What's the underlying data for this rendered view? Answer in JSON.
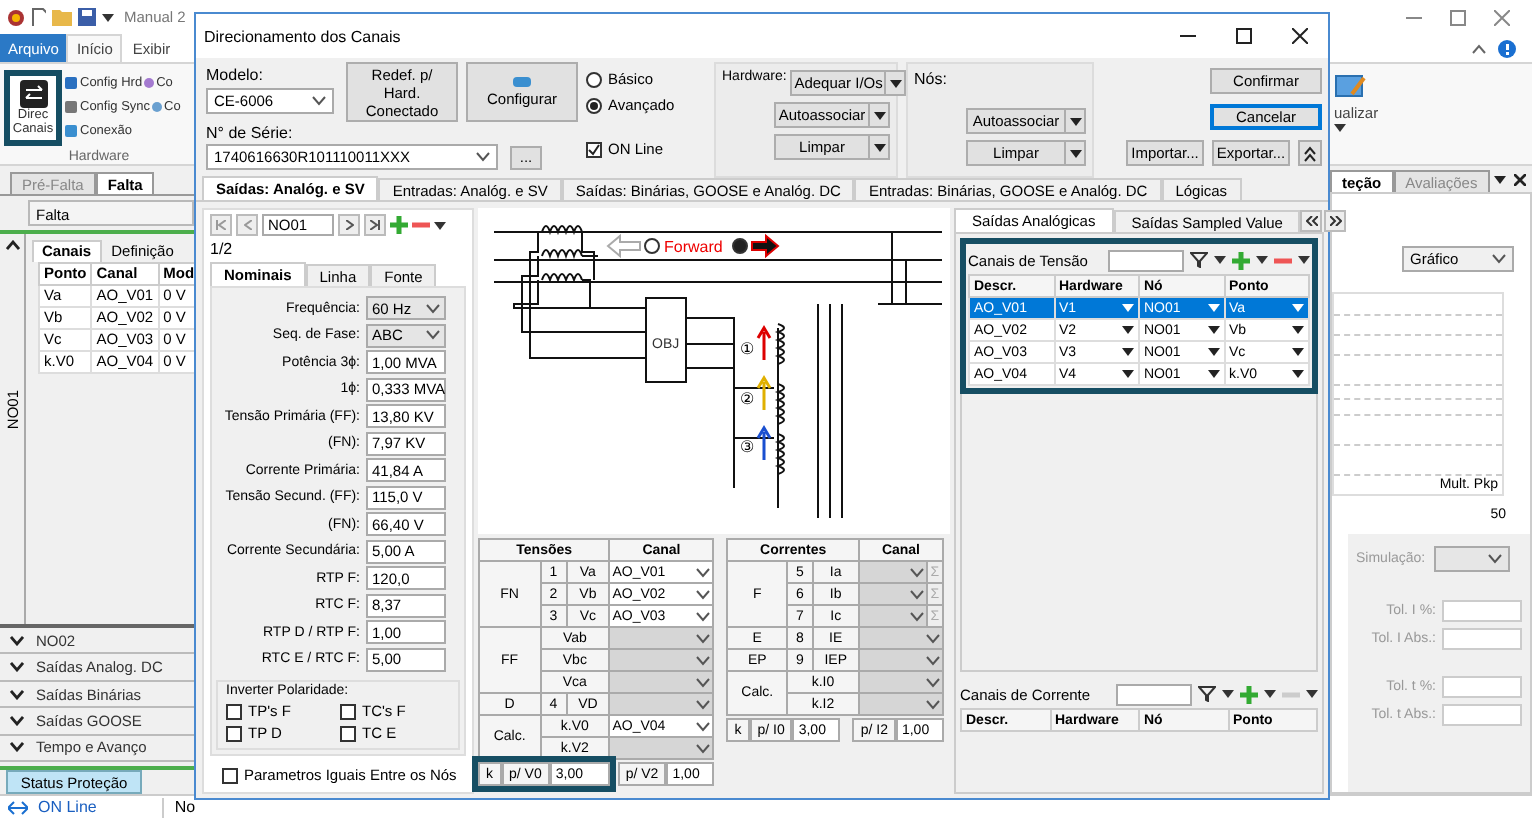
{
  "app": {
    "title": "Manual 2",
    "file_tab": "Arquivo",
    "menu_tabs": [
      {
        "label": "Início",
        "selected": true
      },
      {
        "label": "Exibir",
        "selected": false
      }
    ],
    "ribbon": {
      "main_button": [
        "Direc",
        "Canais"
      ],
      "buttons": [
        "Config Hrd",
        "Config Sync",
        "Conexão"
      ],
      "cut_buttons": [
        "Co",
        "Co"
      ],
      "group_label": "Hardware",
      "update_button": "ualizar"
    }
  },
  "left_panel": {
    "tabs": [
      {
        "label": "Pré-Falta",
        "selected": false
      },
      {
        "label": "Falta",
        "selected": true
      }
    ],
    "field": "Falta",
    "node": {
      "label": "NO01",
      "expanded": true,
      "tabs": [
        {
          "label": "Canais",
          "selected": true
        },
        {
          "label": "Definição",
          "selected": false
        }
      ],
      "columns": [
        "Ponto",
        "Canal",
        "Mod"
      ],
      "rows": [
        [
          "Va",
          "AO_V01",
          "0 V"
        ],
        [
          "Vb",
          "AO_V02",
          "0 V"
        ],
        [
          "Vc",
          "AO_V03",
          "0 V"
        ],
        [
          "k.V0",
          "AO_V04",
          "0 V"
        ]
      ]
    },
    "sections": [
      {
        "label": "NO02",
        "expanded": false
      },
      {
        "label": "Saídas Analog. DC",
        "expanded": false
      },
      {
        "label": "Saídas Binárias",
        "expanded": false
      },
      {
        "label": "Saídas GOOSE",
        "expanded": false
      },
      {
        "label": "Tempo e Avanço",
        "expanded": false
      }
    ],
    "bottom_tab": "Status Proteção"
  },
  "status_bar": {
    "connection": "ON Line",
    "column_2": "No"
  },
  "right_panel": {
    "tabs": [
      {
        "label": "teção",
        "selected": true
      },
      {
        "label": "Avaliações",
        "selected": false
      }
    ],
    "view_select": "Gráfico",
    "chart_label": "Mult. Pkp",
    "axis_value": "50",
    "simulation_label": "Simulação:",
    "fields": [
      "Tol. I %:",
      "Tol. I Abs.:",
      "Tol. t %:",
      "Tol. t Abs.:"
    ]
  },
  "dialog": {
    "title": "Direcionamento dos Canais",
    "model_label": "Modelo:",
    "model": "CE-6006",
    "reset_button": "Redef. p/ Hard. Conectado",
    "configure_button": "Configurar",
    "modes": [
      {
        "label": "Básico",
        "selected": false
      },
      {
        "label": "Avançado",
        "selected": true
      }
    ],
    "serial_label": "N° de Série:",
    "serial": "1740616630R101110011XXX",
    "browse_button": "...",
    "online": {
      "label": "ON Line",
      "checked": true
    },
    "hardware_group": {
      "label": "Hardware:",
      "buttons": [
        "Adequar I/Os",
        "Autoassociar",
        "Limpar"
      ]
    },
    "nodes_group": {
      "label": "Nós:",
      "buttons": [
        "Autoassociar",
        "Limpar"
      ]
    },
    "actions": [
      {
        "label": "Confirmar",
        "focused": false
      },
      {
        "label": "Cancelar",
        "focused": true
      }
    ],
    "import_button": "Importar...",
    "export_button": "Exportar...",
    "tabs": [
      {
        "label": "Saídas: Analóg. e SV",
        "selected": true
      },
      {
        "label": "Entradas: Analóg. e SV",
        "selected": false
      },
      {
        "label": "Saídas: Binárias, GOOSE e Analóg. DC",
        "selected": false
      },
      {
        "label": "Entradas: Binárias, GOOSE e Analóg. DC",
        "selected": false
      },
      {
        "label": "Lógicas",
        "selected": false
      }
    ],
    "navigator": {
      "node": "NO01",
      "page": "1/2"
    },
    "settings_tabs": [
      {
        "label": "Nominais",
        "selected": true
      },
      {
        "label": "Linha",
        "selected": false
      },
      {
        "label": "Fonte",
        "selected": false
      }
    ],
    "settings": [
      {
        "label": "Frequência:",
        "value": "60 Hz",
        "kind": "select"
      },
      {
        "label": "Seq. de Fase:",
        "value": "ABC",
        "kind": "select"
      },
      {
        "label": "Potência 3ϕ:",
        "value": "1,00 MVA",
        "kind": "input"
      },
      {
        "label": "1ϕ:",
        "value": "0,333 MVA",
        "kind": "input"
      },
      {
        "label": "Tensão Primária (FF):",
        "value": "13,80 KV",
        "kind": "input"
      },
      {
        "label": "(FN):",
        "value": "7,97 KV",
        "kind": "input"
      },
      {
        "label": "Corrente Primária:",
        "value": "41,84 A",
        "kind": "input"
      },
      {
        "label": "Tensão Secund. (FF):",
        "value": "115,0 V",
        "kind": "input"
      },
      {
        "label": "(FN):",
        "value": "66,40 V",
        "kind": "input"
      },
      {
        "label": "Corrente Secundária:",
        "value": "5,00 A",
        "kind": "input"
      },
      {
        "label": "RTP F:",
        "value": "120,0",
        "kind": "input"
      },
      {
        "label": "RTC F:",
        "value": "8,37",
        "kind": "input"
      },
      {
        "label": "RTP D / RTP F:",
        "value": "1,00",
        "kind": "input"
      },
      {
        "label": "RTC E / RTC F:",
        "value": "5,00",
        "kind": "input"
      }
    ],
    "polarity": {
      "label": "Inverter Polaridade:",
      "options": [
        {
          "label": "TP's F",
          "checked": false
        },
        {
          "label": "TC's F",
          "checked": false
        },
        {
          "label": "TP D",
          "checked": false
        },
        {
          "label": "TC E",
          "checked": false
        }
      ]
    },
    "same_params": {
      "label": "Parametros Iguais Entre os Nós",
      "checked": false
    },
    "diagram": {
      "directions": [
        {
          "kind": "reverse",
          "selected": false
        },
        {
          "kind": "forward",
          "selected": true
        }
      ],
      "direction_label": "Forward",
      "object_label": "OBJ",
      "ct_labels": [
        "①",
        "②",
        "③"
      ]
    },
    "voltages": {
      "heading": "Tensões",
      "channel_heading": "Canal",
      "groups": [
        {
          "label": "FN",
          "rows": [
            {
              "index": "1",
              "name": "Va",
              "channel": "AO_V01",
              "disabled": false
            },
            {
              "index": "2",
              "name": "Vb",
              "channel": "AO_V02",
              "disabled": false
            },
            {
              "index": "3",
              "name": "Vc",
              "channel": "AO_V03",
              "disabled": false
            }
          ]
        },
        {
          "label": "FF",
          "rows": [
            {
              "name": "Vab",
              "disabled": true
            },
            {
              "name": "Vbc",
              "disabled": true
            },
            {
              "name": "Vca",
              "disabled": true
            }
          ]
        },
        {
          "label": "D",
          "rows": [
            {
              "index": "4",
              "name": "VD",
              "disabled": true
            }
          ]
        },
        {
          "label": "Calc.",
          "rows": [
            {
              "name": "k.V0",
              "channel": "AO_V04",
              "disabled": false
            },
            {
              "name": "k.V2",
              "disabled": true
            }
          ]
        }
      ],
      "factor": {
        "label": "k",
        "items": [
          {
            "label": "p/ V0",
            "value": "3,00"
          },
          {
            "label": "p/ V2",
            "value": "1,00"
          }
        ]
      }
    },
    "currents": {
      "heading": "Correntes",
      "channel_heading": "Canal",
      "groups": [
        {
          "label": "F",
          "rows": [
            {
              "index": "5",
              "name": "Ia",
              "sum": "Σ",
              "disabled": true
            },
            {
              "index": "6",
              "name": "Ib",
              "sum": "Σ",
              "disabled": true
            },
            {
              "index": "7",
              "name": "Ic",
              "sum": "Σ",
              "disabled": true
            }
          ]
        },
        {
          "label": "E",
          "rows": [
            {
              "index": "8",
              "name": "IE",
              "disabled": true
            }
          ]
        },
        {
          "label": "EP",
          "rows": [
            {
              "index": "9",
              "name": "IEP",
              "disabled": true
            }
          ]
        },
        {
          "label": "Calc.",
          "rows": [
            {
              "name": "k.I0",
              "disabled": true
            },
            {
              "name": "k.I2",
              "disabled": true
            }
          ]
        }
      ],
      "factor": {
        "label": "k",
        "items": [
          {
            "label": "p/ I0",
            "value": "3,00"
          },
          {
            "label": "p/ I2",
            "value": "1,00"
          }
        ]
      }
    },
    "outputs": {
      "tabs": [
        {
          "label": "Saídas Analógicas",
          "selected": true
        },
        {
          "label": "Saídas Sampled Value",
          "selected": false
        }
      ],
      "voltage_channels": {
        "label": "Canais de Tensão",
        "remove_disabled": false,
        "columns": [
          "Descr.",
          "Hardware",
          "Nó",
          "Ponto"
        ],
        "rows": [
          {
            "cells": [
              "AO_V01",
              "V1",
              "NO01",
              "Va"
            ],
            "selected": true
          },
          {
            "cells": [
              "AO_V02",
              "V2",
              "NO01",
              "Vb"
            ],
            "selected": false
          },
          {
            "cells": [
              "AO_V03",
              "V3",
              "NO01",
              "Vc"
            ],
            "selected": false
          },
          {
            "cells": [
              "AO_V04",
              "V4",
              "NO01",
              "k.V0"
            ],
            "selected": false
          }
        ]
      },
      "current_channels": {
        "label": "Canais de Corrente",
        "remove_disabled": true,
        "columns": [
          "Descr.",
          "Hardware",
          "Nó",
          "Ponto"
        ]
      }
    }
  }
}
